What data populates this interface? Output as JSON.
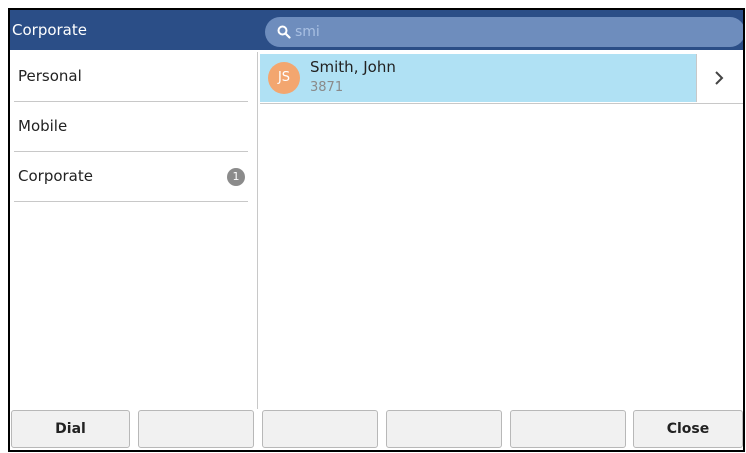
{
  "header": {
    "title": "Corporate"
  },
  "search": {
    "query": "smi"
  },
  "sidebar": {
    "items": [
      {
        "label": "Personal",
        "badge": ""
      },
      {
        "label": "Mobile",
        "badge": ""
      },
      {
        "label": "Corporate",
        "badge": "1"
      }
    ]
  },
  "results": [
    {
      "initials": "JS",
      "name": "Smith, John",
      "number": "3871"
    }
  ],
  "softkeys": [
    "Dial",
    "",
    "",
    "",
    "",
    "Close"
  ],
  "colors": {
    "header_bg": "#2b4e87",
    "search_bg": "#6e8dbd",
    "selected_row": "#b0e1f4",
    "avatar": "#f3a66f",
    "badge": "#8b8b8b"
  },
  "icons": {
    "search": "search-icon",
    "chevron": "chevron-right-icon"
  }
}
